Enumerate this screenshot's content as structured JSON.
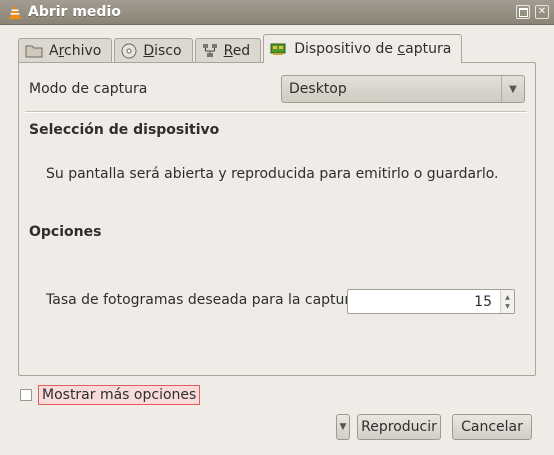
{
  "window": {
    "title": "Abrir medio"
  },
  "tabs": [
    {
      "label": "Archivo",
      "mnemonic_index": 1,
      "icon": "folder-icon"
    },
    {
      "label": "Disco",
      "mnemonic_index": 0,
      "icon": "disc-icon"
    },
    {
      "label": "Red",
      "mnemonic_index": 0,
      "icon": "network-icon"
    },
    {
      "label": "Dispositivo de captura",
      "mnemonic_index": 15,
      "icon": "capture-card-icon",
      "active": true
    }
  ],
  "capture": {
    "mode_label": "Modo de captura",
    "mode_value": "Desktop",
    "device_section_title": "Selección de dispositivo",
    "device_description": "Su pantalla será abierta y reproducida para emitirlo o guardarlo.",
    "options_section_title": "Opciones",
    "fps_label": "Tasa de fotogramas deseada para la captura.",
    "fps_value": "15"
  },
  "footer": {
    "more_options_label": "Mostrar más opciones",
    "play_label": "Reproducir",
    "cancel_label": "Cancelar"
  },
  "colors": {
    "accent_highlight": "#e35b5b",
    "titlebar": "#8a8477"
  }
}
